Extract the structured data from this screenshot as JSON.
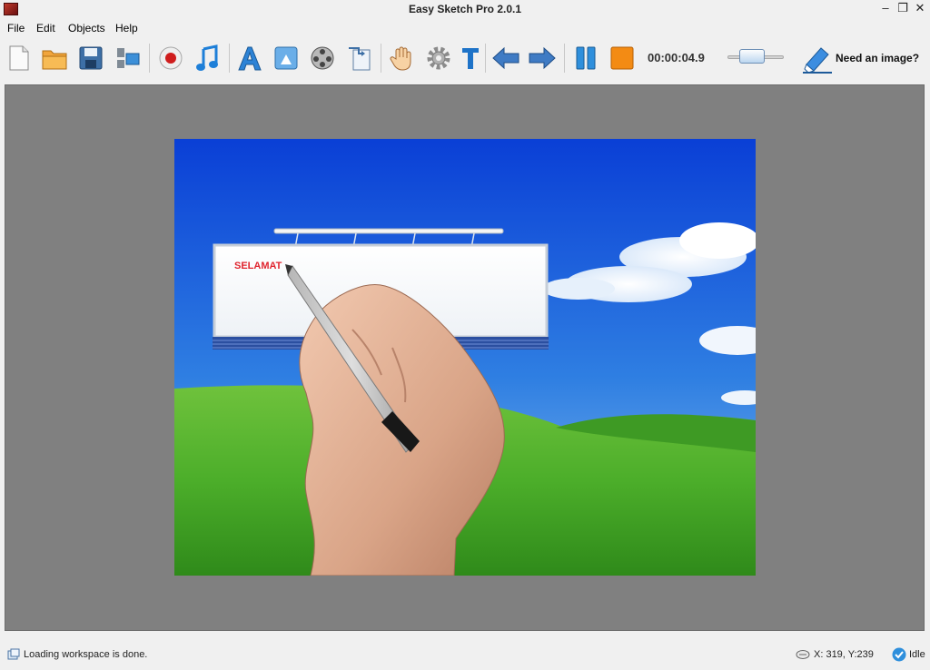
{
  "window": {
    "title": "Easy Sketch Pro 2.0.1",
    "controls": {
      "minimize": "–",
      "restore": "❐",
      "close": "✕"
    }
  },
  "menu": {
    "items": [
      {
        "label": "File"
      },
      {
        "label": "Edit"
      },
      {
        "label": "Objects"
      },
      {
        "label": "Help"
      }
    ]
  },
  "toolbar": {
    "icons": [
      "new-file-icon",
      "open-folder-icon",
      "save-disk-icon",
      "export-icon",
      "record-icon",
      "music-note-icon",
      "text-a-icon",
      "image-icon",
      "film-reel-icon",
      "import-icon",
      "hand-icon",
      "gear-icon",
      "text-t-icon",
      "arrow-left-icon",
      "arrow-right-icon",
      "pause-icon",
      "stop-icon"
    ],
    "timer": "00:00:04.9",
    "need_image_label": "Need an image?"
  },
  "canvas": {
    "billboard_text": "SELAMAT",
    "colors": {
      "sky_top": "#0a3fd6",
      "sky_bottom": "#6aaae8",
      "grass": "#4cae2a",
      "text": "#e0242e"
    }
  },
  "status": {
    "message": "Loading workspace is done.",
    "coords": "X: 319, Y:239",
    "state": "Idle"
  }
}
